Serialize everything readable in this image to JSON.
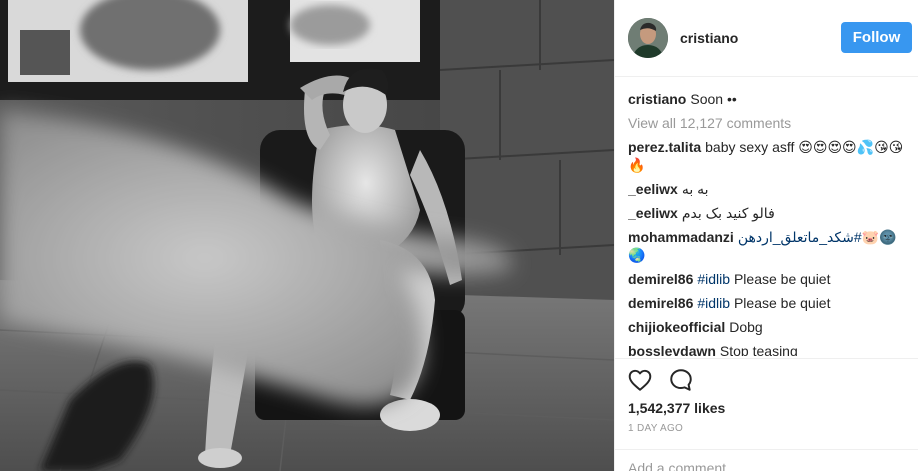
{
  "post": {
    "author": "cristiano",
    "caption": "Soon ••",
    "follow_label": "Follow",
    "view_all": "View all 12,127 comments",
    "likes": "1,542,377 likes",
    "timestamp": "1 DAY AGO",
    "add_comment_placeholder": "Add a comment…"
  },
  "comments": [
    {
      "user": "perez.talita",
      "text": "baby sexy asff 😍😍😍😍💦😘😘🔥"
    },
    {
      "user": "_eeliwx",
      "text": "به به"
    },
    {
      "user": "_eeliwx",
      "text": "فالو کنید بک بدم"
    },
    {
      "user": "mohammadanzi",
      "tag": "#شكد_ماتعلق_اردهن",
      "text": "🐷🌚🌏"
    },
    {
      "user": "demirel86",
      "tag": "#idlib",
      "text": "Please be quiet"
    },
    {
      "user": "demirel86",
      "tag": "#idlib",
      "text": "Please be quiet"
    },
    {
      "user": "chijiokeofficial",
      "text": "Dobg"
    },
    {
      "user": "bosslevdawn",
      "text": "Stop teasing"
    }
  ],
  "icons": {
    "like": "heart-outline-icon",
    "comment": "speech-bubble-icon"
  },
  "colors": {
    "follow_button": "#3897f0",
    "hashtag": "#003569",
    "muted": "#999999"
  }
}
